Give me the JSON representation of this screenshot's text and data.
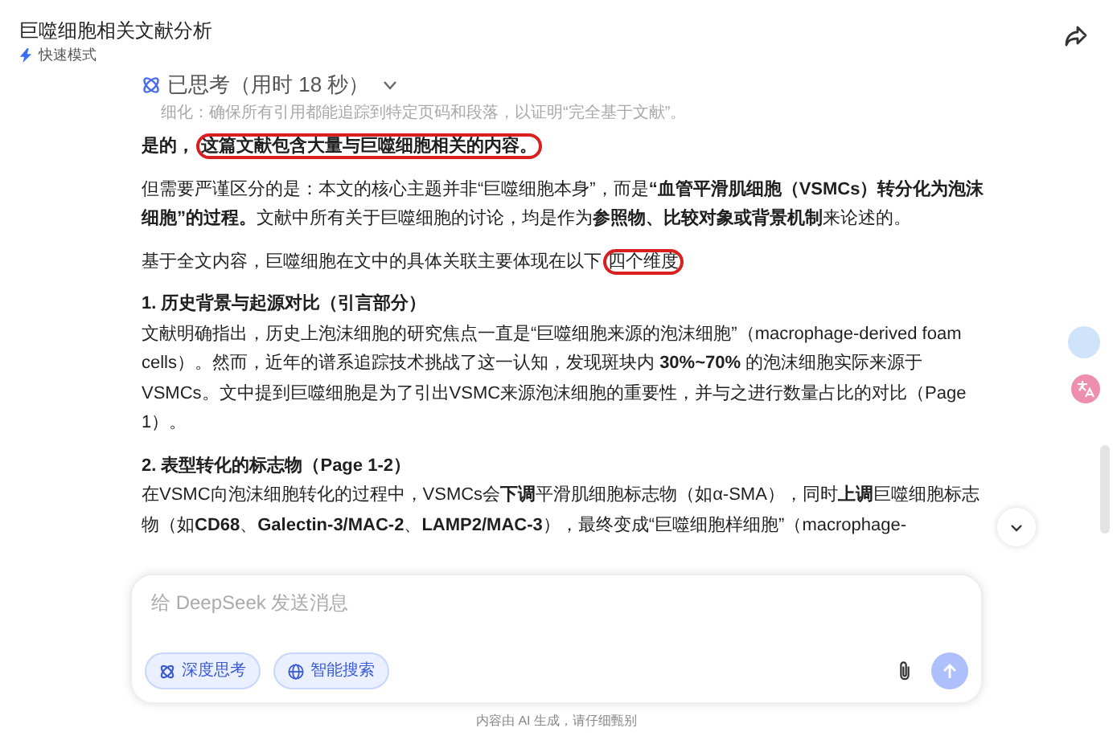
{
  "header": {
    "title": "巨噬细胞相关文献分析",
    "mode": "快速模式"
  },
  "thinking": {
    "label": "已思考（用时 18 秒）",
    "expanded": false
  },
  "faded_line": "细化：确保所有引用都能追踪到特定页码和段落，以证明“完全基于文献”。",
  "paragraphs": [
    {
      "kind": "strong",
      "parts": [
        {
          "text": "是的，",
          "circled": false
        },
        {
          "text": "这篇文献包含大量与巨噬细胞相关的内容。",
          "circled": true
        }
      ]
    },
    {
      "kind": "text",
      "parts": [
        {
          "text": "但需要严谨区分的是：本文的核心主题并非“巨噬细胞本身”，而是**“血管平滑肌细胞（VSMCs）转分化为泡沫细胞”的过程。**文献中所有关于巨噬细胞的讨论，均是作为**参照物、比较对象或背景机制**来论述的。",
          "circled": false
        }
      ]
    },
    {
      "kind": "text",
      "parts": [
        {
          "text": "基于全文内容，巨噬细胞在文中的具体关联主要体现在以下",
          "circled": false
        },
        {
          "text": "四个维度",
          "circled": true
        }
      ]
    },
    {
      "kind": "heading",
      "parts": [
        {
          "text": "1. 历史背景与起源对比（引言部分）",
          "circled": false
        }
      ]
    },
    {
      "kind": "text",
      "parts": [
        {
          "text": "文献明确指出，历史上泡沫细胞的研究焦点一直是“巨噬细胞来源的泡沫细胞”（macrophage-derived foam cells）。然而，近年的谱系追踪技术挑战了这一认知，发现斑块内 **30%~70%** 的泡沫细胞实际来源于VSMCs。文中提到巨噬细胞是为了引出VSMC来源泡沫细胞的重要性，并与之进行数量占比的对比（Page 1）。",
          "circled": false
        }
      ]
    },
    {
      "kind": "heading",
      "parts": [
        {
          "text": "2. 表型转化的标志物（Page 1-2）",
          "circled": false
        }
      ]
    },
    {
      "kind": "text",
      "parts": [
        {
          "text": "在VSMC向泡沫细胞转化的过程中，VSMCs会**下调**平滑肌细胞标志物（如α-SMA），同时**上调**巨噬细胞标志物（如**CD68**、**Galectin-3/MAC-2**、**LAMP2/MAC-3**），最终变成“巨噬细胞样细胞”（macrophage-",
          "circled": false
        }
      ]
    }
  ],
  "composer": {
    "placeholder": "给 DeepSeek 发送消息",
    "toggles": [
      {
        "label": "深度思考",
        "selected": true
      },
      {
        "label": "智能搜索",
        "selected": true
      }
    ],
    "send_disabled": true
  },
  "footer": "内容由 AI 生成，请仔细甄别"
}
